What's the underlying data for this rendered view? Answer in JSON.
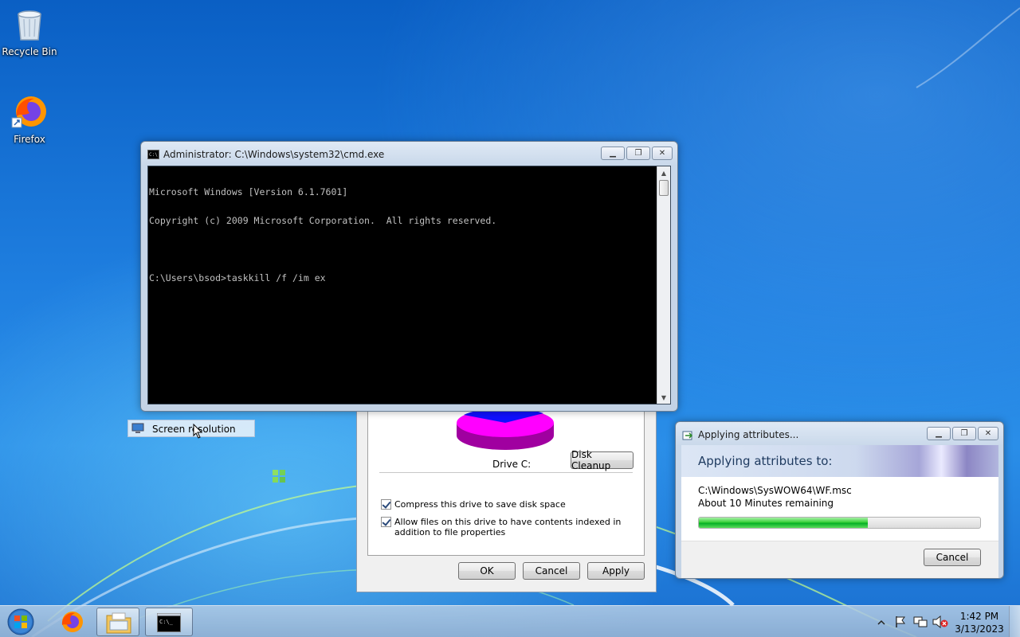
{
  "desktop": {
    "icons": [
      {
        "label": "Recycle Bin"
      },
      {
        "label": "Firefox"
      }
    ]
  },
  "cmd": {
    "title": "Administrator: C:\\Windows\\system32\\cmd.exe",
    "lines": [
      "Microsoft Windows [Version 6.1.7601]",
      "Copyright (c) 2009 Microsoft Corporation.  All rights reserved.",
      "",
      "C:\\Users\\bsod>taskkill /f /im ex"
    ]
  },
  "context_menu": {
    "item": "Screen resolution"
  },
  "drive_props": {
    "drive_label": "Drive C:",
    "disk_cleanup": "Disk Cleanup",
    "compress_label": "Compress this drive to save disk space",
    "compress_checked": true,
    "index_label": "Allow files on this drive to have contents indexed in addition to file properties",
    "index_checked": true,
    "ok": "OK",
    "cancel": "Cancel",
    "apply": "Apply",
    "pie_colors": {
      "used": "#1010ff",
      "free": "#ff00ff"
    }
  },
  "apply_dialog": {
    "title": "Applying attributes...",
    "heading": "Applying attributes to:",
    "path": "C:\\Windows\\SysWOW64\\WF.msc",
    "remaining": "About 10 Minutes remaining",
    "progress": 0.6,
    "cancel": "Cancel"
  },
  "taskbar": {
    "time": "1:42 PM",
    "date": "3/13/2023"
  }
}
